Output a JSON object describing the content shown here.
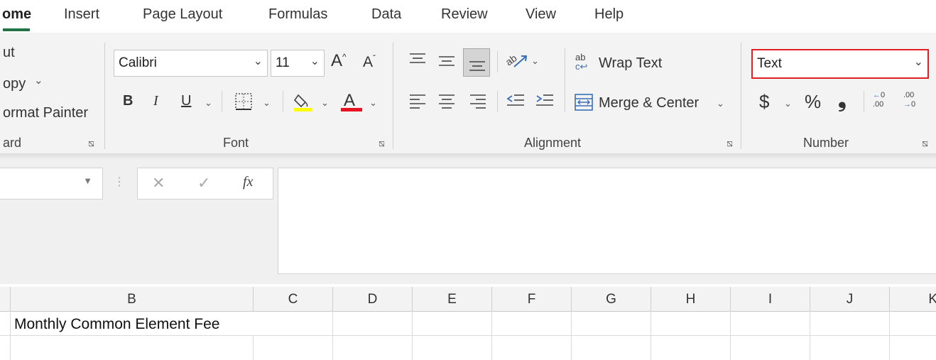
{
  "tabs": [
    "ome",
    "Insert",
    "Page Layout",
    "Formulas",
    "Data",
    "Review",
    "View",
    "Help"
  ],
  "clipboard": {
    "cut_label": "ut",
    "copy_label": "opy",
    "format_painter_label": "ormat Painter",
    "group_label": "ard"
  },
  "font": {
    "family_value": "Calibri",
    "size_value": "11",
    "grow_label": "A",
    "shrink_label": "A",
    "bold_label": "B",
    "italic_label": "I",
    "underline_label": "U",
    "font_color_label": "A",
    "group_label": "Font",
    "highlight_color": "#ffff00",
    "font_color": "#e81123"
  },
  "alignment": {
    "wrap_text_label": "Wrap Text",
    "wrap_icon_label": "ab",
    "merge_center_label": "Merge & Center",
    "group_label": "Alignment"
  },
  "number": {
    "format_value": "Text",
    "currency_label": "$",
    "percent_label": "%",
    "comma_label": "❟",
    "group_label": "Number",
    "highlight_border_color": "#e02020"
  },
  "formula_bar": {
    "fx_label": "fx",
    "cancel_label": "✕",
    "enter_label": "✓",
    "options_label": "⋮"
  },
  "sheet": {
    "columns": [
      "B",
      "C",
      "D",
      "E",
      "F",
      "G",
      "H",
      "I",
      "J",
      "K"
    ],
    "cell_b1": "Monthly Common Element Fee"
  },
  "accent_color": "#217346"
}
